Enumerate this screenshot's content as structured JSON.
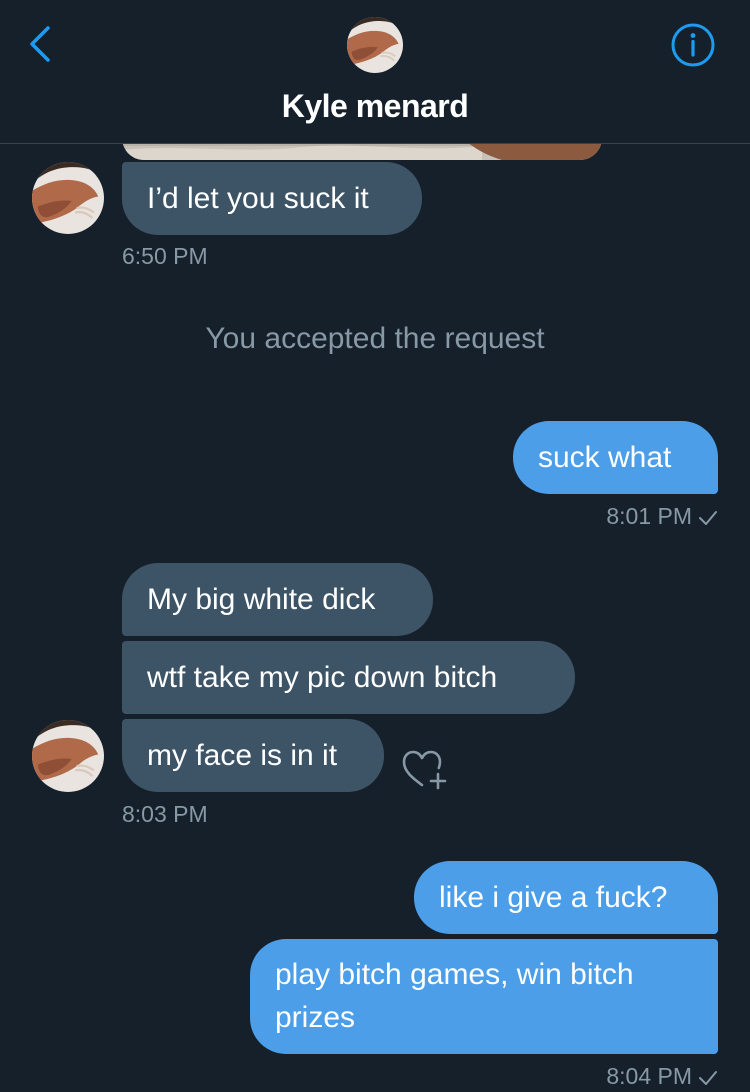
{
  "header": {
    "title": "Kyle menard",
    "back_icon": "chevron-left-icon",
    "info_icon": "info-circle-icon",
    "accent_color": "#1d9bf0"
  },
  "messages": [
    {
      "id": "m1",
      "side": "in",
      "text": "I’d let you suck it"
    },
    {
      "id": "m2",
      "side": "out",
      "text": "suck what"
    },
    {
      "id": "m3",
      "side": "in",
      "text": "My big white dick"
    },
    {
      "id": "m4",
      "side": "in",
      "text": "wtf take my pic down bitch"
    },
    {
      "id": "m5",
      "side": "in",
      "text": "my face is in it"
    },
    {
      "id": "m6",
      "side": "out",
      "text": "like i give a fuck?"
    },
    {
      "id": "m7",
      "side": "out",
      "text": "play bitch games, win bitch prizes"
    }
  ],
  "timestamps": {
    "t1": "6:50 PM",
    "t2": "8:01 PM",
    "t3": "8:03 PM",
    "t4": "8:04 PM"
  },
  "system": {
    "accepted": "You accepted the request"
  },
  "colors": {
    "background": "#15202b",
    "incoming_bubble": "#3d5466",
    "outgoing_bubble": "#4c9ee8",
    "meta_text": "#8899a6"
  }
}
